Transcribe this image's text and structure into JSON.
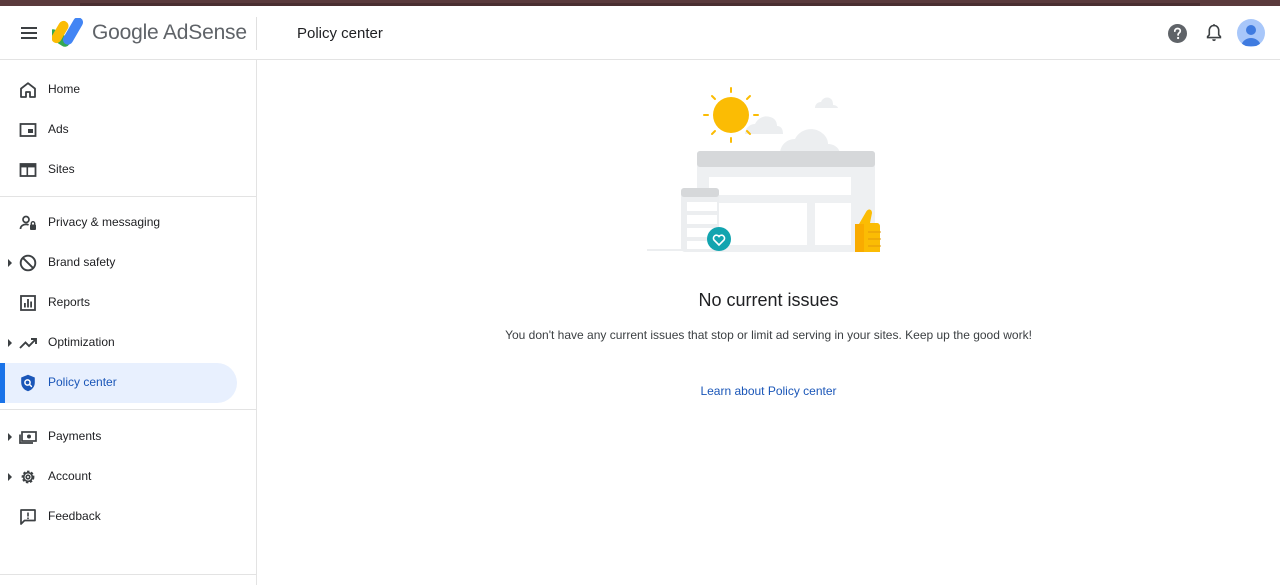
{
  "app": {
    "brand": "Google AdSense",
    "page_title": "Policy center"
  },
  "colors": {
    "accent": "#1a73e8",
    "active_bg": "#e8f0fe",
    "link": "#1a56b8",
    "sun": "#fbbc04"
  },
  "header": {
    "icons": [
      "menu-icon",
      "help-icon",
      "notifications-icon",
      "account-avatar"
    ]
  },
  "sidebar": {
    "items": [
      {
        "label": "Home",
        "icon": "home-icon",
        "expandable": false
      },
      {
        "label": "Ads",
        "icon": "ads-icon",
        "expandable": false
      },
      {
        "label": "Sites",
        "icon": "sites-icon",
        "expandable": false
      },
      {
        "label": "Privacy & messaging",
        "icon": "privacy-icon",
        "expandable": false
      },
      {
        "label": "Brand safety",
        "icon": "block-icon",
        "expandable": true
      },
      {
        "label": "Reports",
        "icon": "reports-icon",
        "expandable": false
      },
      {
        "label": "Optimization",
        "icon": "trending-up-icon",
        "expandable": true
      },
      {
        "label": "Policy center",
        "icon": "shield-search-icon",
        "expandable": false,
        "active": true
      },
      {
        "label": "Payments",
        "icon": "payments-icon",
        "expandable": true
      },
      {
        "label": "Account",
        "icon": "gear-icon",
        "expandable": true
      },
      {
        "label": "Feedback",
        "icon": "feedback-icon",
        "expandable": false
      }
    ]
  },
  "main": {
    "empty_state": {
      "title": "No current issues",
      "description": "You don't have any current issues that stop or limit ad serving in your sites. Keep up the good work!",
      "link": "Learn about Policy center"
    }
  }
}
